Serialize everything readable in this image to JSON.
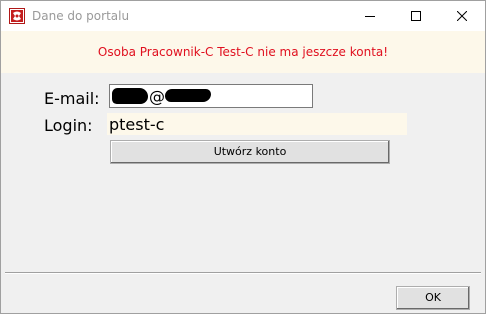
{
  "window": {
    "title": "Dane do portalu",
    "app_icon": "app-logo-icon",
    "controls": {
      "minimize_icon": "minimize-icon",
      "maximize_icon": "maximize-icon",
      "close_icon": "close-icon"
    }
  },
  "banner": {
    "message": "Osoba Pracownik-C Test-C nie ma jeszcze konta!",
    "text_color": "#e0101f",
    "background": "#fdf8ea"
  },
  "form": {
    "email_label": "E-mail:",
    "email_value_visible": "@",
    "login_label": "Login:",
    "login_value": "ptest-c",
    "create_button_label": "Utwórz konto"
  },
  "footer": {
    "ok_label": "OK"
  }
}
